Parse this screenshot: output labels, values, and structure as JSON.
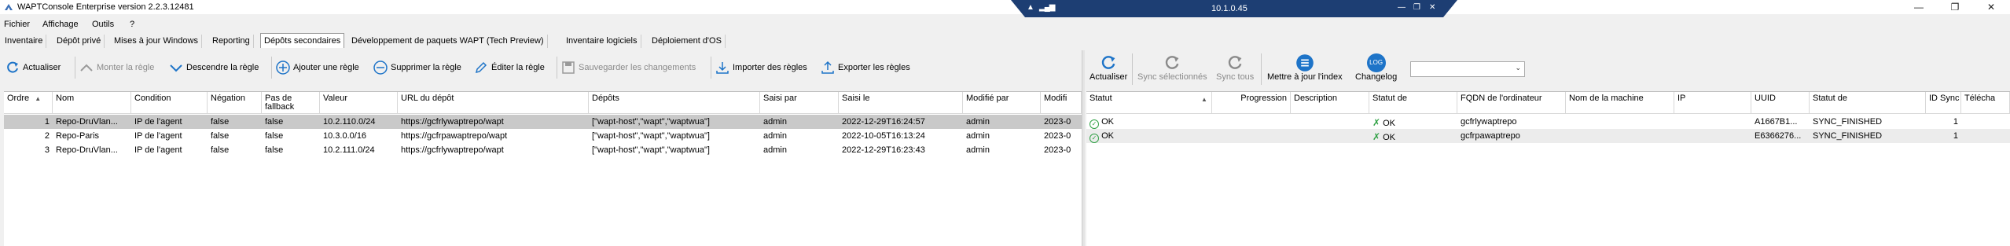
{
  "window": {
    "title": "WAPTConsole Enterprise version 2.2.3.12481"
  },
  "rdp": {
    "ip": "10.1.0.45"
  },
  "menu": [
    "Fichier",
    "Affichage",
    "Outils",
    "?"
  ],
  "tabs": [
    "Inventaire",
    "Dépôt privé",
    "Mises à jour Windows",
    "Reporting",
    "Dépôts secondaires",
    "Développement de paquets WAPT (Tech Preview)",
    "Inventaire logiciels",
    "Déploiement d'OS"
  ],
  "active_tab": 4,
  "left_toolbar": {
    "refresh": "Actualiser",
    "move_up": "Monter la règle",
    "move_down": "Descendre la règle",
    "add_rule": "Ajouter une règle",
    "delete_rule": "Supprimer la règle",
    "edit_rule": "Éditer la règle",
    "save_changes": "Sauvegarder les changements",
    "import_rules": "Importer des règles",
    "export_rules": "Exporter les règles"
  },
  "rules_table": {
    "columns": [
      "Ordre",
      "Nom",
      "Condition",
      "Négation",
      "Pas de fallback",
      "Valeur",
      "URL du dépôt",
      "Dépôts",
      "Saisi par",
      "Saisi le",
      "Modifié par",
      "Modifi"
    ],
    "rows": [
      [
        "1",
        "Repo-DruVlan...",
        "IP de l'agent",
        "false",
        "false",
        "10.2.110.0/24",
        "https://gcfrlywaptrepo/wapt",
        "[\"wapt-host\",\"wapt\",\"waptwua\"]",
        "admin",
        "2022-12-29T16:24:57",
        "admin",
        "2023-0"
      ],
      [
        "2",
        "Repo-Paris",
        "IP de l'agent",
        "false",
        "false",
        "10.3.0.0/16",
        "https://gcfrpawaptrepo/wapt",
        "[\"wapt-host\",\"wapt\",\"waptwua\"]",
        "admin",
        "2022-10-05T16:13:24",
        "admin",
        "2023-0"
      ],
      [
        "3",
        "Repo-DruVlan...",
        "IP de l'agent",
        "false",
        "false",
        "10.2.111.0/24",
        "https://gcfrlywaptrepo/wapt",
        "[\"wapt-host\",\"wapt\",\"waptwua\"]",
        "admin",
        "2022-12-29T16:23:43",
        "admin",
        "2023-0"
      ]
    ]
  },
  "right_toolbar": {
    "refresh": "Actualiser",
    "sync_selected": "Sync sélectionnés",
    "sync_all": "Sync tous",
    "update_index": "Mettre à jour l'index",
    "changelog": "Changelog",
    "changelog_badge": "LOG",
    "combo_value": ""
  },
  "agents_table": {
    "columns": [
      "Statut",
      "Progression",
      "Description",
      "Statut de",
      "FQDN de l'ordinateur",
      "Nom de la machine",
      "IP",
      "UUID",
      "Statut de",
      "ID Sync",
      "Télécha"
    ],
    "rows": [
      [
        "OK",
        "",
        "",
        "OK",
        "gcfrlywaptrepo",
        "",
        "",
        "A1667B1...",
        "SYNC_FINISHED",
        "1"
      ],
      [
        "OK",
        "",
        "",
        "OK",
        "gcfrpawaptrepo",
        "",
        "",
        "E6366276...",
        "SYNC_FINISHED",
        "1"
      ]
    ]
  },
  "colors": {
    "accent": "#1e74c8",
    "selected_row": "#c9c9c9",
    "rdp_bar": "#1d3e73"
  }
}
